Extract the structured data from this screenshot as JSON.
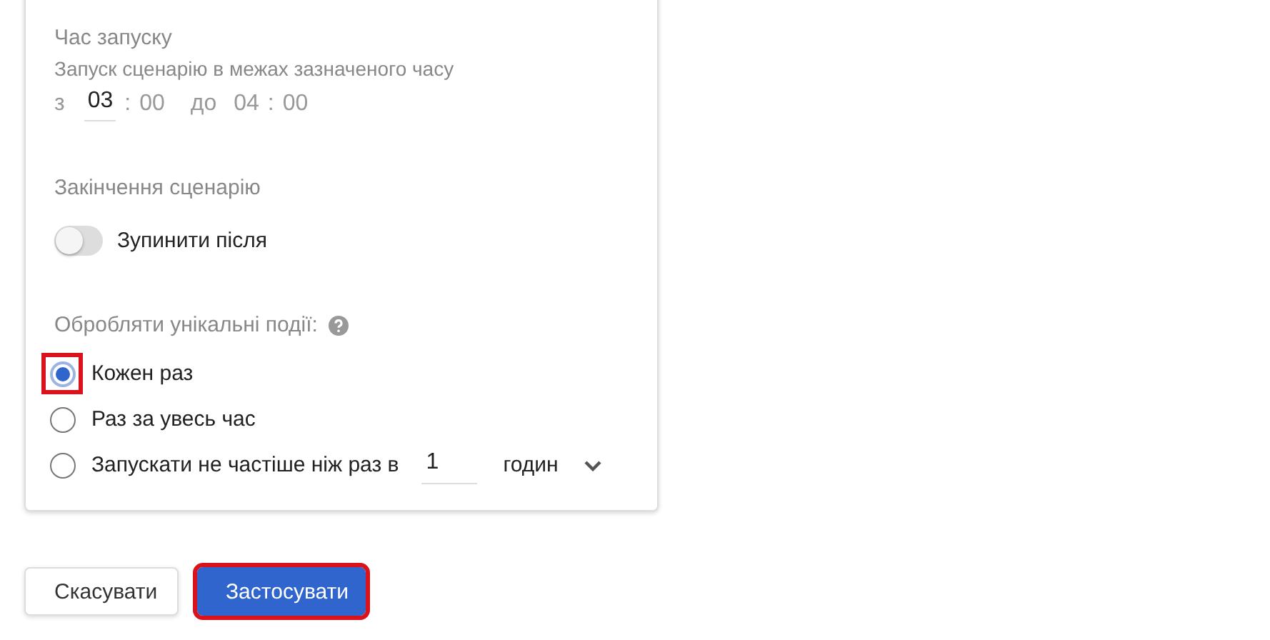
{
  "run_time": {
    "title": "Час запуску",
    "description": "Запуск сценарію в межах зазначеного часу",
    "from_label": "з",
    "from_hours": "03",
    "from_separator": ":",
    "from_minutes": "00",
    "to_label": "до",
    "to_hours": "04",
    "to_separator": ":",
    "to_minutes": "00"
  },
  "scenario_end": {
    "title": "Закінчення сценарію",
    "toggle": {
      "label": "Зупинити після",
      "on": false
    }
  },
  "unique_events": {
    "title": "Обробляти унікальні події:",
    "options": [
      {
        "kind": "plain",
        "label": "Кожен раз",
        "selected": true,
        "highlighted": true
      },
      {
        "kind": "plain",
        "label": "Раз за увесь час",
        "selected": false,
        "highlighted": false
      },
      {
        "kind": "interval",
        "label": "Запускати не частіше ніж раз в",
        "value": "1",
        "unit": "годин",
        "selected": false,
        "highlighted": false
      }
    ]
  },
  "buttons": [
    {
      "kind": "secondary",
      "label": "Скасувати",
      "highlighted": false
    },
    {
      "kind": "primary",
      "label": "Застосувати",
      "highlighted": true
    }
  ]
}
